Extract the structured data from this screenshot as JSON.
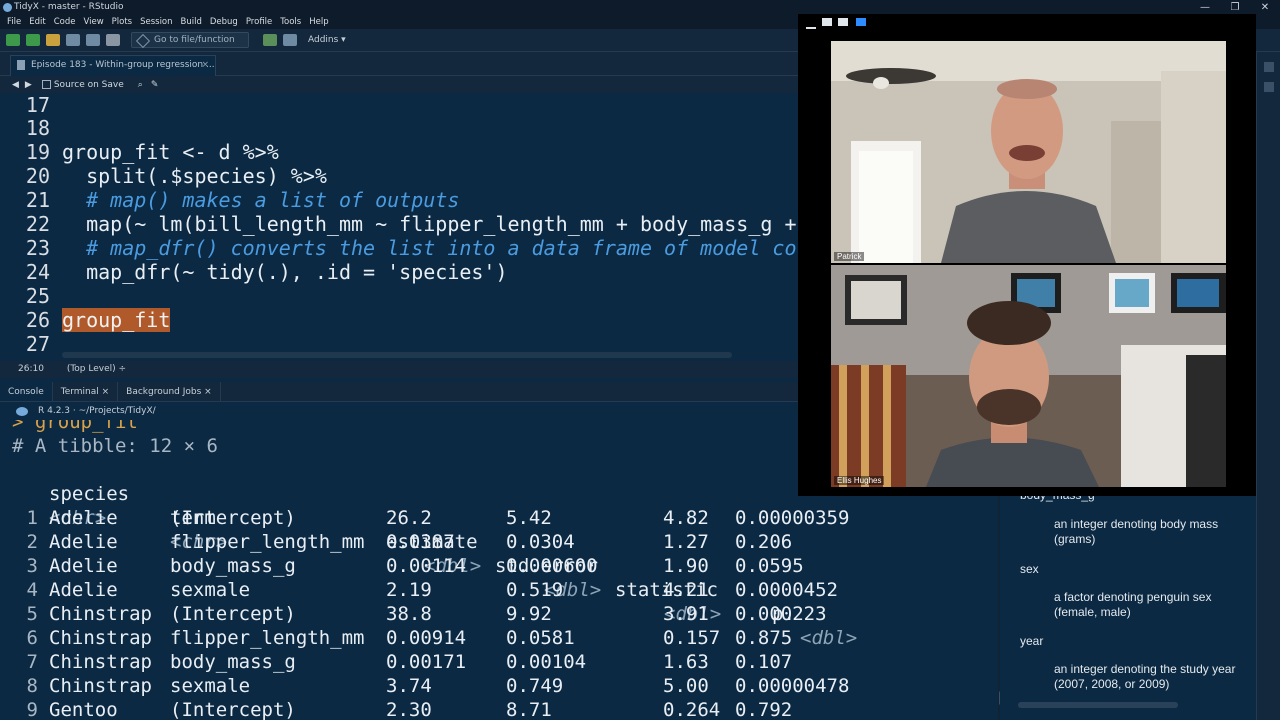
{
  "window": {
    "title": "TidyX - master - RStudio",
    "controls": [
      "—",
      "❐",
      "✕"
    ]
  },
  "menu": [
    "File",
    "Edit",
    "Code",
    "View",
    "Plots",
    "Session",
    "Build",
    "Debug",
    "Profile",
    "Tools",
    "Help"
  ],
  "toolbar": {
    "goto_label": "Go to file/function",
    "addins_label": "Addins ▾"
  },
  "editor": {
    "tab_label": "Episode 183 - Within-group regression ...",
    "source_on_save": "Source on Save",
    "lines": [
      {
        "num": "17",
        "text": ""
      },
      {
        "num": "18",
        "text": ""
      },
      {
        "num": "19",
        "text": "group_fit <- d %>%"
      },
      {
        "num": "20",
        "text": "  split(.$species) %>%"
      },
      {
        "num": "21",
        "text": "  # map() makes a list of outputs"
      },
      {
        "num": "22",
        "text": "  map(~ lm(bill_length_mm ~ flipper_length_mm + body_mass_g +"
      },
      {
        "num": "23",
        "text": "  # map_dfr() converts the list into a data frame of model co"
      },
      {
        "num": "24",
        "text": "  map_dfr(~ tidy(.), .id = 'species')"
      },
      {
        "num": "25",
        "text": ""
      },
      {
        "num": "26",
        "text": "group_fit"
      },
      {
        "num": "27",
        "text": ""
      }
    ],
    "status_pos": "26:10",
    "status_scope": "(Top Level) ÷"
  },
  "console": {
    "tabs": [
      "Console",
      "Terminal ×",
      "Background Jobs ×"
    ],
    "r_version": "R 4.2.3 · ~/Projects/TidyX/",
    "prompt": "> group_fit",
    "tibble_header": "# A tibble: 12 × 6",
    "columns": [
      "species",
      "term",
      "estimate",
      "std.error",
      "statistic",
      "p."
    ],
    "types": [
      "<chr>",
      "<chr>",
      "<dbl>",
      "<dbl>",
      "<dbl>",
      "<dbl>"
    ],
    "rows": [
      {
        "i": "1",
        "species": "Adelie",
        "term": "(Intercept)",
        "estimate": "26.2",
        "se": "5.42",
        "stat": "4.82",
        "p": "0.00000359"
      },
      {
        "i": "2",
        "species": "Adelie",
        "term": "flipper_length_mm",
        "estimate": "0.0387",
        "se": "0.0304",
        "stat": "1.27",
        "p": "0.206"
      },
      {
        "i": "3",
        "species": "Adelie",
        "term": "body_mass_g",
        "estimate": "0.00114",
        "se": "0.000600",
        "stat": "1.90",
        "p": "0.0595"
      },
      {
        "i": "4",
        "species": "Adelie",
        "term": "sexmale",
        "estimate": "2.19",
        "se": "0.519",
        "stat": "4.21",
        "p": "0.0000452"
      },
      {
        "i": "5",
        "species": "Chinstrap",
        "term": "(Intercept)",
        "estimate": "38.8",
        "se": "9.92",
        "stat": "3.91",
        "p": "0.000223"
      },
      {
        "i": "6",
        "species": "Chinstrap",
        "term": "flipper_length_mm",
        "estimate": "0.00914",
        "se": "0.0581",
        "stat": "0.157",
        "p": "0.875"
      },
      {
        "i": "7",
        "species": "Chinstrap",
        "term": "body_mass_g",
        "estimate": "0.00171",
        "se": "0.00104",
        "stat": "1.63",
        "p": "0.107"
      },
      {
        "i": "8",
        "species": "Chinstrap",
        "term": "sexmale",
        "estimate": "3.74",
        "se": "0.749",
        "stat": "5.00",
        "p": "0.00000478"
      },
      {
        "i": "9",
        "species": "Gentoo",
        "term": "(Intercept)",
        "estimate": "2.30",
        "se": "8.71",
        "stat": "0.264",
        "p": "0.792"
      }
    ]
  },
  "help": {
    "items": [
      {
        "term": "body_mass_g",
        "desc": "an integer denoting body mass (grams)"
      },
      {
        "term": "sex",
        "desc": "a factor denoting penguin sex (female, male)"
      },
      {
        "term": "year",
        "desc": "an integer denoting the study year (2007, 2008, or 2009)"
      }
    ]
  },
  "video": {
    "participant1": "Patrick",
    "participant2": "Ellis Hughes"
  },
  "colors": {
    "background": "#0b2942",
    "highlight": "#b05a2c",
    "string": "#a5e36b",
    "comment": "#4b9be0"
  }
}
